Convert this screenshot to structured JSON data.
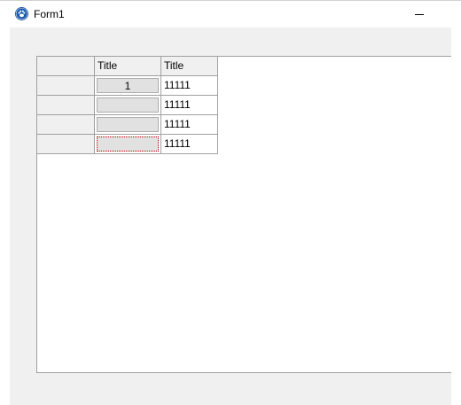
{
  "window": {
    "title": "Form1",
    "minimize_glyph": "minimize-icon",
    "app_icon": "paw-icon"
  },
  "grid": {
    "columns": [
      {
        "title": ""
      },
      {
        "title": "Title"
      },
      {
        "title": "Title"
      }
    ],
    "rows": [
      {
        "button": "1",
        "value": "11111",
        "focused": false
      },
      {
        "button": "",
        "value": "11111",
        "focused": false
      },
      {
        "button": "",
        "value": "11111",
        "focused": false
      },
      {
        "button": "",
        "value": "11111",
        "focused": true
      }
    ]
  },
  "colors": {
    "form_background": "#f0f0f0",
    "grid_lines": "#a0a0a0",
    "focus_border": "#c00000"
  }
}
